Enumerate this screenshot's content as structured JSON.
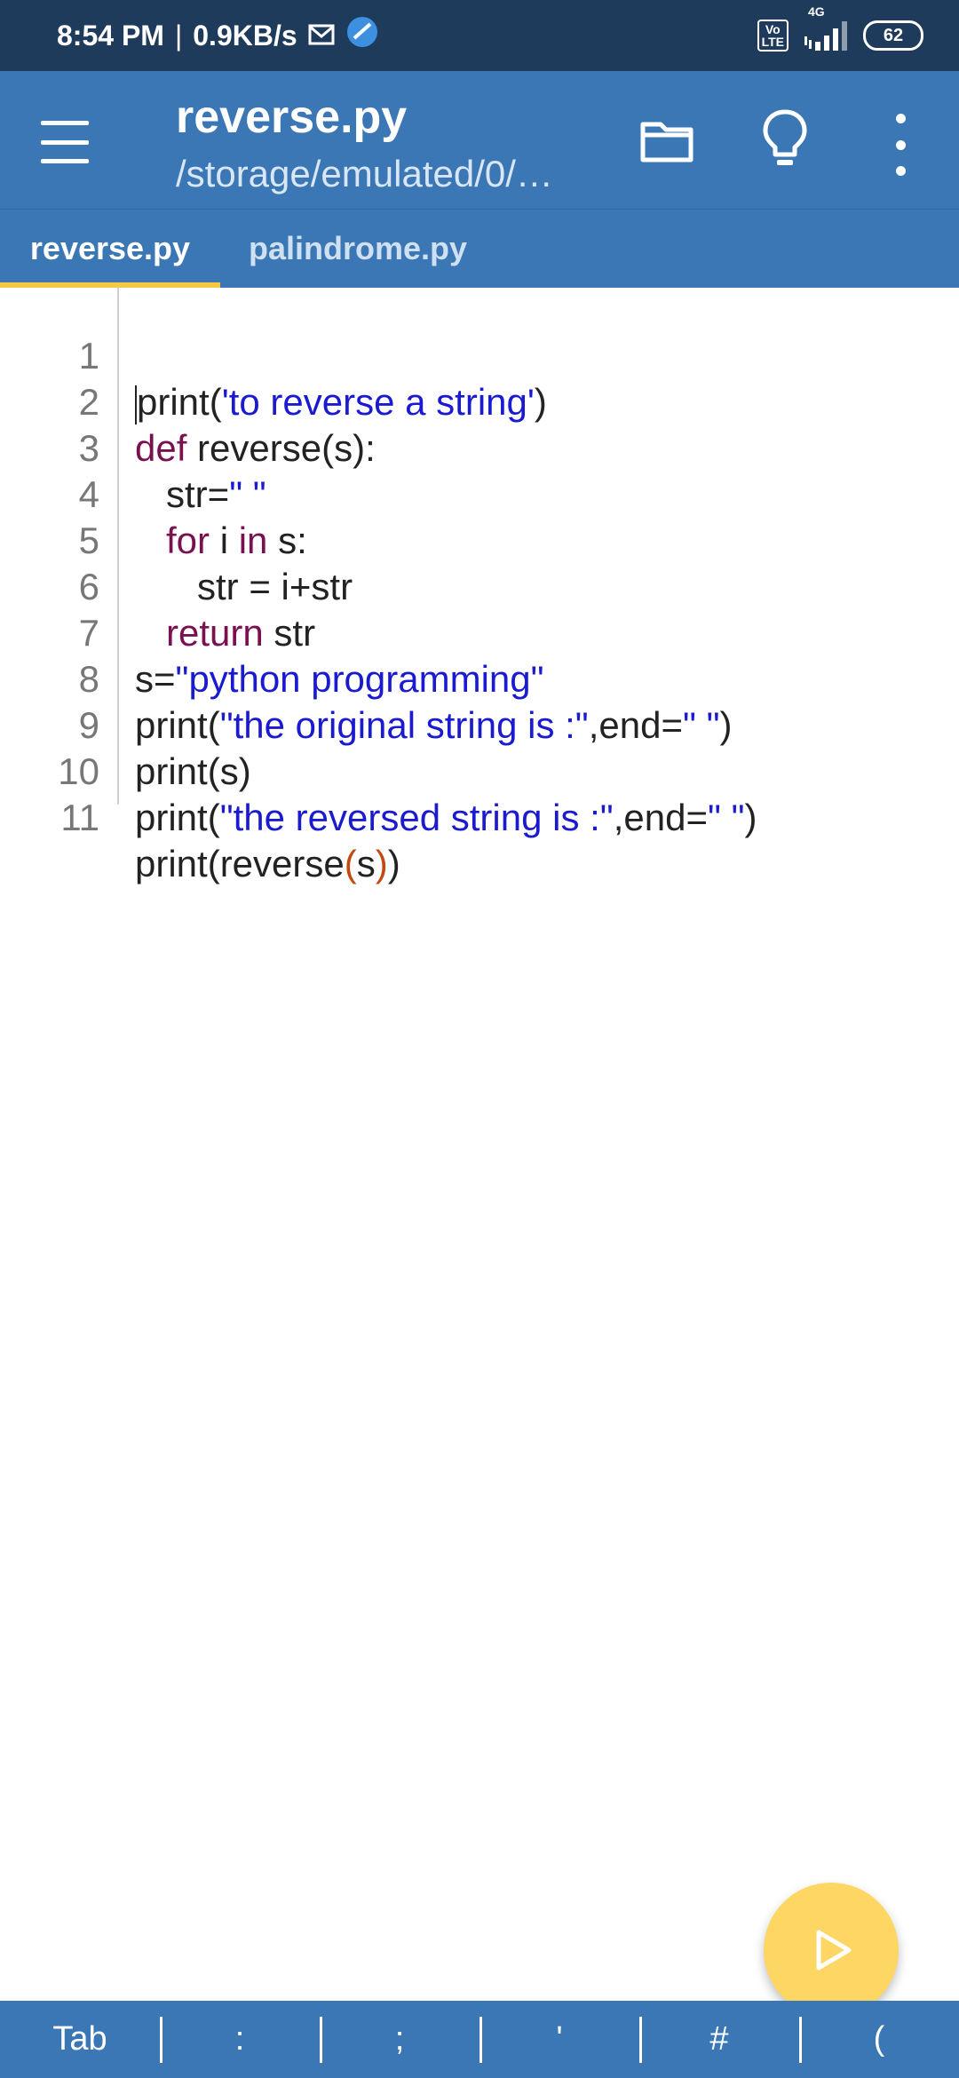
{
  "status": {
    "time": "8:54 PM",
    "separator": "|",
    "speed": "0.9KB/s",
    "network": "4G",
    "volte": "Vo\nLTE",
    "battery": "62"
  },
  "appbar": {
    "title": "reverse.py",
    "path": "/storage/emulated/0/…"
  },
  "tabs": [
    {
      "label": "reverse.py"
    },
    {
      "label": "palindrome.py"
    }
  ],
  "code": {
    "line_numbers": [
      "1",
      "2",
      "3",
      "4",
      "5",
      "6",
      "7",
      "8",
      "9",
      "10",
      "11"
    ],
    "l1": {
      "a": "print(",
      "b": "'to reverse a string'",
      "c": ")"
    },
    "l2": {
      "kw": "def",
      "rest": " reverse(s):"
    },
    "l3": {
      "indent": "   ",
      "a": "str=",
      "b": "\" \""
    },
    "l4": {
      "indent": "   ",
      "kw1": "for",
      "mid": " i ",
      "kw2": "in",
      "rest": " s:"
    },
    "l5": {
      "indent": "      ",
      "rest": "str = i+str"
    },
    "l6": {
      "indent": "   ",
      "kw": "return",
      "rest": " str"
    },
    "l7": {
      "a": "s=",
      "b": "\"python programming\""
    },
    "l8": {
      "a": "print(",
      "b": "\"the original string is :\"",
      "c": ",end=",
      "d": "\" \"",
      "e": ")"
    },
    "l9": {
      "a": "print(s)"
    },
    "l10": {
      "a": "print(",
      "b": "\"the reversed string is :\"",
      "c": ",end=",
      "d": "\" \"",
      "e": ")"
    },
    "l11": {
      "a": "print(reverse",
      "b": "(",
      "c": "s",
      "d": ")",
      "e": ")"
    }
  },
  "symbols": [
    "Tab",
    ":",
    ";",
    "'",
    "#",
    "("
  ],
  "icons": {
    "menu": "hamburger-menu-icon",
    "folder": "folder-icon",
    "bulb": "lightbulb-icon",
    "more": "more-vert-icon",
    "run": "play-icon"
  },
  "colors": {
    "appbar": "#3a77b4",
    "statusbar": "#1f3b5c",
    "accent": "#f6c844",
    "fab": "#fdd663",
    "keyword": "#7a1050",
    "string": "#1a1ad0"
  }
}
